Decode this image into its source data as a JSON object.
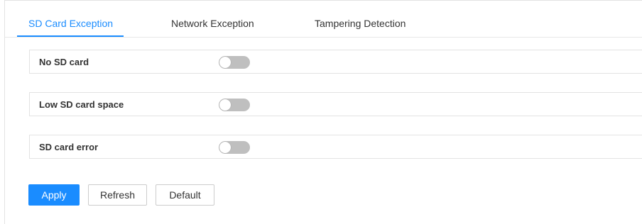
{
  "tabs": [
    {
      "label": "SD Card Exception",
      "active": true
    },
    {
      "label": "Network Exception",
      "active": false
    },
    {
      "label": "Tampering Detection",
      "active": false
    }
  ],
  "settings": [
    {
      "label": "No SD card",
      "enabled": false
    },
    {
      "label": "Low SD card space",
      "enabled": false
    },
    {
      "label": "SD card error",
      "enabled": false
    }
  ],
  "buttons": {
    "apply": "Apply",
    "refresh": "Refresh",
    "default": "Default"
  },
  "colors": {
    "accent": "#1a8cff",
    "toggle_off": "#bfbfbf",
    "border": "#e3e3e3"
  }
}
